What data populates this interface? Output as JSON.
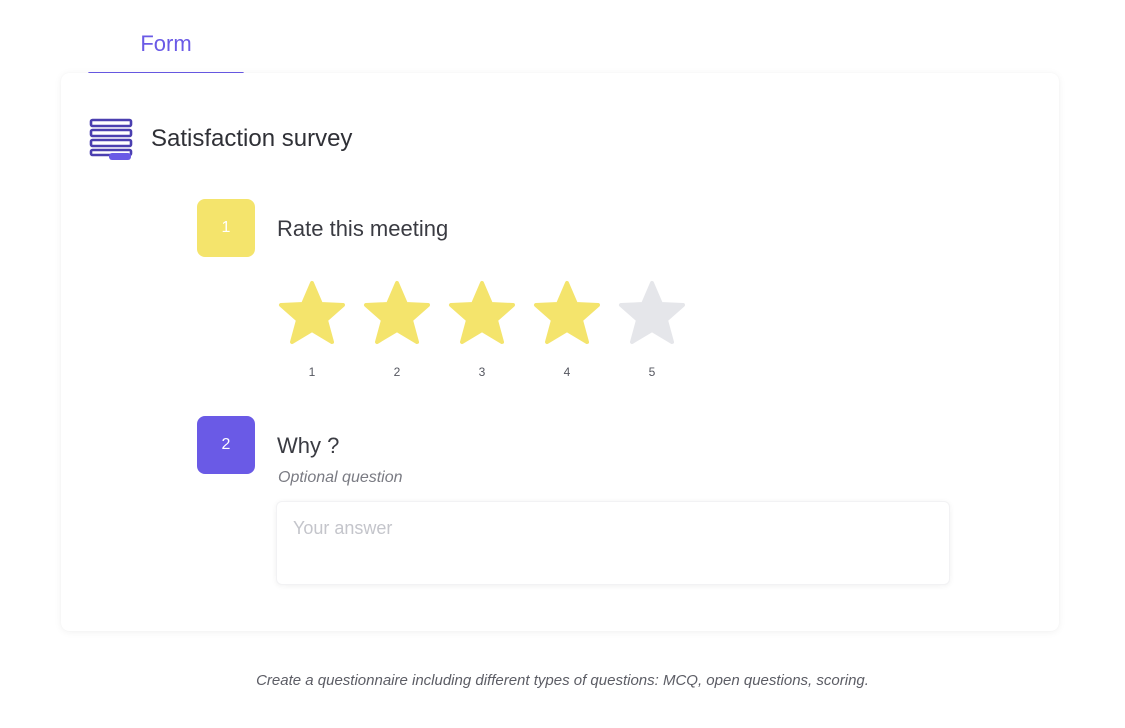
{
  "tab": {
    "label": "Form",
    "active_color": "#6a5ae6"
  },
  "survey": {
    "title": "Satisfaction survey",
    "icon": "form-lines-icon"
  },
  "questions": [
    {
      "number": "1",
      "title": "Rate this meeting",
      "badge_color": "#f4e46c",
      "rating": {
        "selected": 4,
        "max": 5,
        "labels": [
          "1",
          "2",
          "3",
          "4",
          "5"
        ],
        "filled_color": "#f4e46c",
        "empty_color": "#e5e6ea",
        "icon": "star-icon"
      }
    },
    {
      "number": "2",
      "title": "Why ?",
      "badge_color": "#6a5ae6",
      "note": "Optional question",
      "answer": {
        "value": "",
        "placeholder": "Your answer"
      }
    }
  ],
  "caption": "Create a questionnaire including different types of questions: MCQ, open questions, scoring."
}
